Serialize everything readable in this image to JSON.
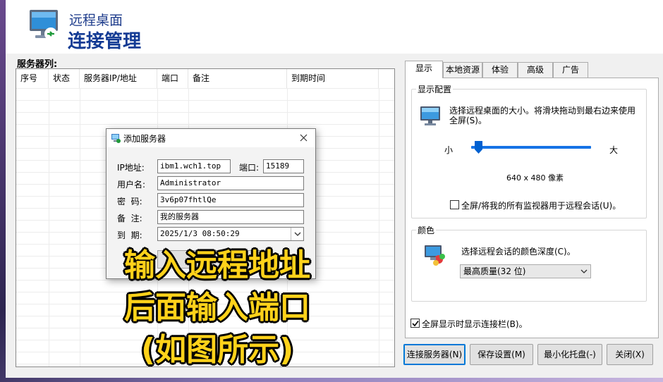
{
  "header": {
    "title_small": "远程桌面",
    "title_large": "连接管理"
  },
  "server_list": {
    "label": "服务器列:",
    "columns": [
      "序号",
      "状态",
      "服务器IP/地址",
      "端口",
      "备注",
      "到期时间"
    ]
  },
  "dialog": {
    "title": "添加服务器",
    "fields": {
      "ip_label": "IP地址:",
      "ip_value": "ibm1.wch1.top",
      "port_label": "端口:",
      "port_value": "15189",
      "user_label": "用户名:",
      "user_value": "Administrator",
      "password_label": "密  码:",
      "password_value": "3v6p07fhtlQe",
      "note_label": "备  注:",
      "note_value": "我的服务器",
      "expire_label": "到  期:",
      "expire_value": "2025/1/3 08:50:29"
    }
  },
  "overlay": {
    "line1": "输入远程地址",
    "line2": "后面输入端口",
    "line3": "(如图所示)"
  },
  "tabs": [
    "显示",
    "本地资源",
    "体验",
    "高级",
    "广告"
  ],
  "display_config": {
    "legend": "显示配置",
    "description": "选择远程桌面的大小。将滑块拖动到最右边来使用全屏(S)。",
    "small_label": "小",
    "large_label": "大",
    "slider_level": 0.03,
    "resolution": "640 x 480 像素",
    "all_monitors_label": "全屏/将我的所有监视器用于远程会话(U)。",
    "all_monitors_checked": false
  },
  "color": {
    "legend": "颜色",
    "description": "选择远程会话的颜色深度(C)。",
    "selected": "最高质量(32 位)"
  },
  "fullscreen_bar_label": "全屏显示时显示连接栏(B)。",
  "fullscreen_bar_checked": true,
  "buttons": {
    "connect": "连接服务器(N)",
    "save": "保存设置(M)",
    "minimize": "最小化托盘(-)",
    "close": "关闭(X)"
  },
  "colors": {
    "accent": "#1673e6",
    "title_blue": "#133b94",
    "overlay_yellow": "#ffd21a"
  }
}
